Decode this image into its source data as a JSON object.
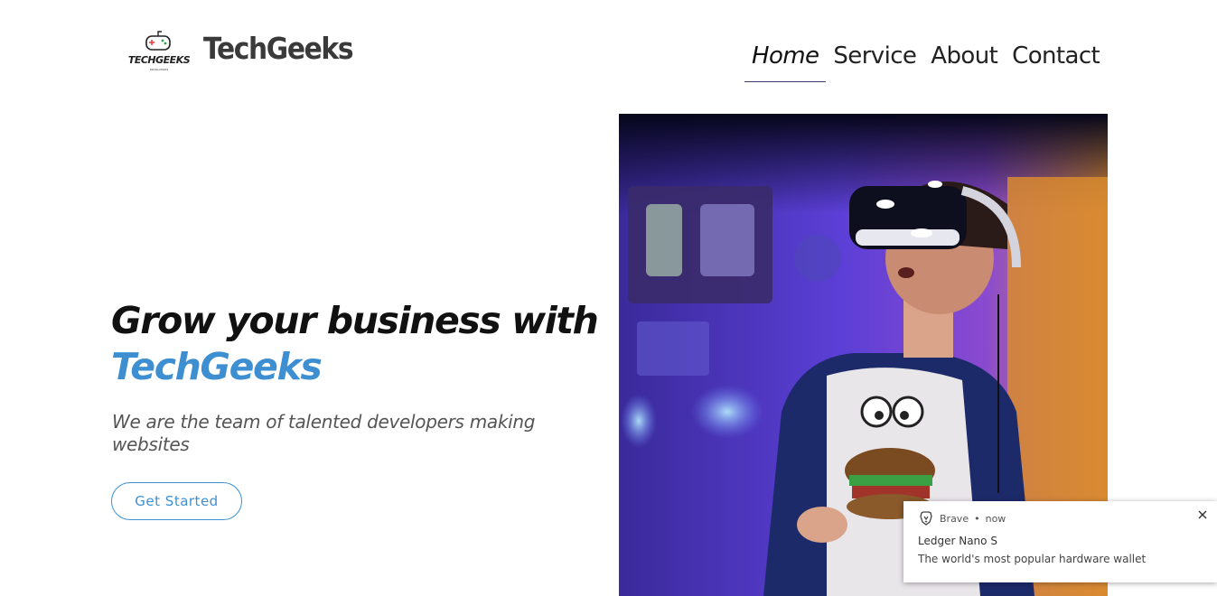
{
  "brand": {
    "logo_word": "TECHGEEKS",
    "logo_tagline": "DEVELOPERS",
    "name": "TechGeeks"
  },
  "nav": {
    "items": [
      {
        "label": "Home",
        "active": true
      },
      {
        "label": "Service",
        "active": false
      },
      {
        "label": "About",
        "active": false
      },
      {
        "label": "Contact",
        "active": false
      }
    ]
  },
  "hero": {
    "title_line1": "Grow your business with",
    "title_accent": "TechGeeks",
    "subtitle": "We are the team of talented developers making websites",
    "cta_label": "Get Started",
    "image_icon": "vr-gamer-photo"
  },
  "notification": {
    "app": "Brave",
    "time": "now",
    "title": "Ledger Nano S",
    "body": "The world's most popular hardware wallet",
    "icon": "brave-lion-icon"
  },
  "colors": {
    "accent": "#3e8fd1",
    "text_dark": "#111111",
    "subtitle_gray": "#555555"
  }
}
